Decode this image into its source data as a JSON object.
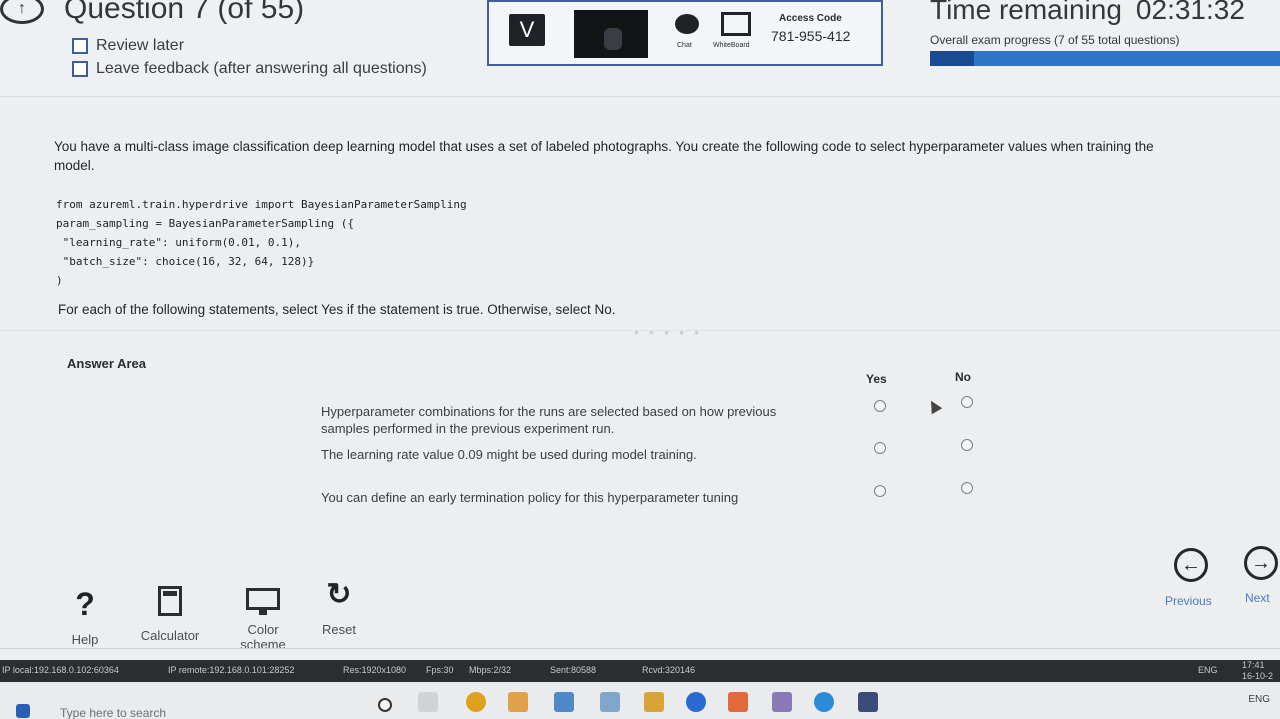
{
  "header": {
    "question_title": "Question 7 (of 55)",
    "review_later": "Review later",
    "leave_feedback": "Leave feedback (after answering all questions)",
    "proctor": {
      "v_label": "V",
      "chat_label": "Chat",
      "whiteboard_label": "WhiteBoard",
      "access_code_label": "Access Code",
      "access_code": "781-955-412"
    },
    "time_label": "Time remaining",
    "time_value": "02:31:32",
    "progress_text": "Overall exam progress (7 of 55 total questions)",
    "progress_fraction": 0.127
  },
  "question": {
    "text": "You have a multi-class image classification deep learning model that uses a set of labeled photographs. You create the following code to select hyperparameter values when training the model.",
    "code_lines": [
      "from azureml.train.hyperdrive import BayesianParameterSampling",
      "param_sampling = BayesianParameterSampling ({",
      " \"learning_rate\": uniform(0.01, 0.1),",
      " \"batch_size\": choice(16, 32, 64, 128)}",
      ")"
    ],
    "instruction": "For each of the following statements, select Yes if the statement is true. Otherwise, select No."
  },
  "answer_area": {
    "title": "Answer Area",
    "yes_label": "Yes",
    "no_label": "No",
    "statements": [
      "Hyperparameter combinations for the runs are selected based on how previous samples performed in the previous experiment run.",
      "The learning rate value 0.09 might be used during model training.",
      "You can define an early termination policy for this hyperparameter tuning"
    ]
  },
  "toolbar": {
    "help": "Help",
    "calculator": "Calculator",
    "color_scheme": "Color scheme",
    "reset": "Reset",
    "previous": "Previous",
    "next": "Next"
  },
  "status_bar": {
    "ip_local": "IP local:192.168.0.102:60364",
    "ip_remote": "IP remote:192.168.0.101:28252",
    "res": "Res:1920x1080",
    "fps": "Fps:30",
    "mbps": "Mbps:2/32",
    "sent": "Sent:80588",
    "rcvd": "Rcvd:320146",
    "lang": "ENG",
    "clock_time": "17:41",
    "clock_date": "16-10-2"
  },
  "taskbar": {
    "search_placeholder": "Type here to search",
    "lang": "ENG"
  }
}
